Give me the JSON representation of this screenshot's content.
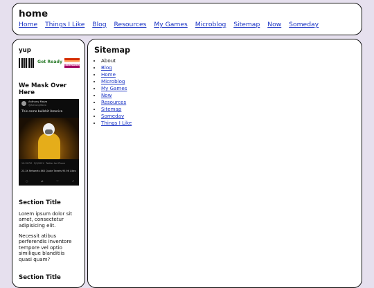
{
  "header": {
    "title": "home",
    "nav": [
      "Home",
      "Things I Like",
      "Blog",
      "Resources",
      "My Games",
      "Microblog",
      "Sitemap",
      "Now",
      "Someday"
    ]
  },
  "sidebar": {
    "section1_title": "yup",
    "badges": {
      "ready_text": "Get Ready",
      "flag_text": "KEYPLAYER"
    },
    "section2_title": "We Mask Over Here",
    "tweet": {
      "name": "Anthony Maiza",
      "handle": "@AnthonyMaiza",
      "text": "This come bullshit America",
      "meta": "10:19 PM · 5/1/2021 · Twitter for iPhone",
      "stats": "23.1K Retweets  863 Quote Tweets  95.9K Likes",
      "icons": [
        "reply-icon",
        "retweet-icon",
        "like-icon",
        "share-icon"
      ]
    },
    "section3_title": "Section Title",
    "para1": "Lorem ipsum dolor sit amet, consectetur adipisicing elit.",
    "para2": "Necessit atibus perferendis inventore tempore vel optio similique blanditiis quasi quam?",
    "section4_title": "Section Title"
  },
  "main": {
    "title": "Sitemap",
    "items": [
      {
        "label": "About",
        "link": false
      },
      {
        "label": "Blog",
        "link": true
      },
      {
        "label": "Home",
        "link": true
      },
      {
        "label": "Microblog",
        "link": true
      },
      {
        "label": "My Games",
        "link": true
      },
      {
        "label": "Now",
        "link": true
      },
      {
        "label": "Resources",
        "link": true
      },
      {
        "label": "Sitemap",
        "link": true
      },
      {
        "label": "Someday",
        "link": true
      },
      {
        "label": "Things I Like",
        "link": true
      }
    ]
  },
  "colors": {
    "background": "#e6e0ee",
    "link": "#1a33c4",
    "panel": "#ffffff",
    "border": "#111111"
  }
}
